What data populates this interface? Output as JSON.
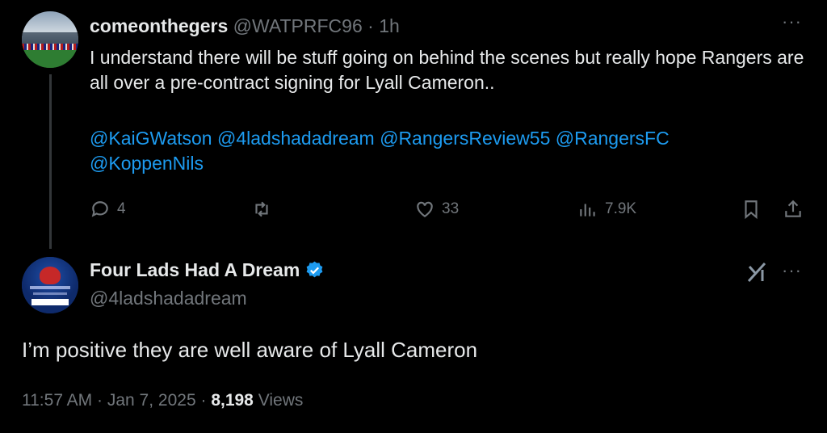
{
  "parent": {
    "username": "comeonthegers",
    "handle": "@WATPRFC96",
    "separator": "·",
    "time": "1h",
    "text": "I understand there will be stuff going on behind the scenes but really hope Rangers are all over a pre-contract signing for Lyall Cameron..",
    "mentions": [
      "@KaiGWatson",
      "@4ladshadadream",
      "@RangersReview55",
      "@RangersFC",
      "@KoppenNils"
    ],
    "actions": {
      "replies": "4",
      "likes": "33",
      "views": "7.9K"
    }
  },
  "reply": {
    "display_name": "Four Lads Had A Dream",
    "handle": "@4ladshadadream",
    "text": "I’m positive they are well aware of Lyall Cameron",
    "time": "11:57 AM",
    "date": "Jan 7, 2025",
    "separator": "·",
    "views_count": "8,198",
    "views_label": "Views"
  },
  "more_label": "···",
  "colors": {
    "background": "#000000",
    "text": "#e7e9ea",
    "muted": "#71767b",
    "link": "#1d9bf0",
    "verified": "#1d9bf0",
    "thread_line": "#333639"
  },
  "icons": [
    "reply-icon",
    "retweet-icon",
    "like-icon",
    "views-icon",
    "bookmark-icon",
    "share-icon",
    "verified-badge-icon",
    "grok-icon",
    "more-icon"
  ]
}
